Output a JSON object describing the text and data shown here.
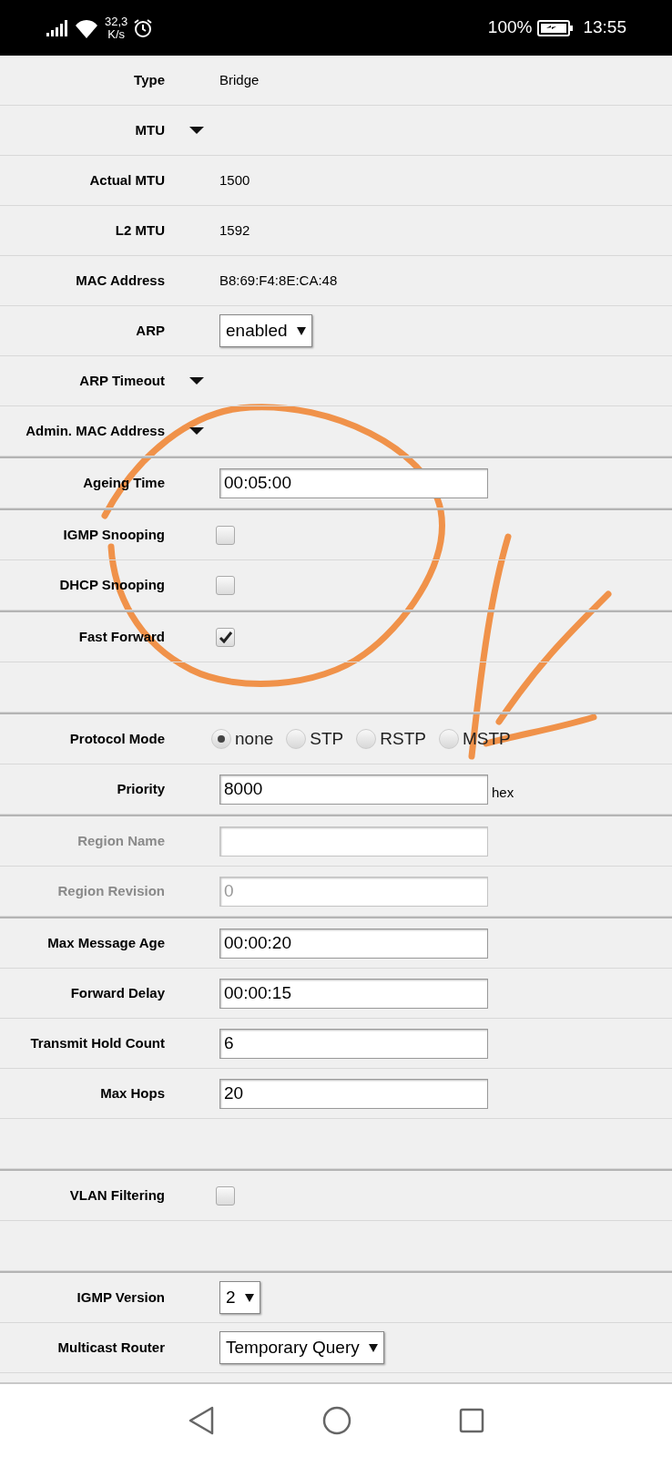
{
  "status_bar": {
    "speed": "32,3",
    "speed_unit": "K/s",
    "battery": "100%",
    "time": "13:55"
  },
  "sections": [
    {
      "rows": [
        {
          "kind": "text",
          "label": "Type",
          "value": "Bridge"
        },
        {
          "kind": "toggle",
          "label": "MTU"
        },
        {
          "kind": "text",
          "label": "Actual MTU",
          "value": "1500"
        },
        {
          "kind": "text",
          "label": "L2 MTU",
          "value": "1592"
        },
        {
          "kind": "text",
          "label": "MAC Address",
          "value": "B8:69:F4:8E:CA:48"
        },
        {
          "kind": "select",
          "label": "ARP",
          "value": "enabled"
        },
        {
          "kind": "toggle",
          "label": "ARP Timeout"
        },
        {
          "kind": "toggle",
          "label": "Admin. MAC Address"
        }
      ]
    },
    {
      "rows": [
        {
          "kind": "input",
          "label": "Ageing Time",
          "value": "00:05:00",
          "disabled": false
        }
      ]
    },
    {
      "rows": [
        {
          "kind": "checkbox",
          "label": "IGMP Snooping",
          "checked": false
        },
        {
          "kind": "checkbox",
          "label": "DHCP Snooping",
          "checked": false
        }
      ]
    },
    {
      "rows": [
        {
          "kind": "checkbox",
          "label": "Fast Forward",
          "checked": true
        },
        {
          "kind": "spacer"
        }
      ]
    },
    {
      "rows": [
        {
          "kind": "radio",
          "label": "Protocol Mode",
          "options": [
            {
              "label": "none",
              "selected": true
            },
            {
              "label": "STP",
              "selected": false
            },
            {
              "label": "RSTP",
              "selected": false
            },
            {
              "label": "MSTP",
              "selected": false
            }
          ]
        },
        {
          "kind": "input",
          "label": "Priority",
          "value": "8000",
          "suffix": "hex",
          "disabled": false
        }
      ]
    },
    {
      "rows": [
        {
          "kind": "input",
          "label": "Region Name",
          "disabled": true
        },
        {
          "kind": "input",
          "label": "Region Revision",
          "value": "0",
          "disabled": true
        }
      ]
    },
    {
      "rows": [
        {
          "kind": "input",
          "label": "Max Message Age",
          "value": "00:00:20",
          "disabled": false
        },
        {
          "kind": "input",
          "label": "Forward Delay",
          "value": "00:00:15",
          "disabled": false
        },
        {
          "kind": "input",
          "label": "Transmit Hold Count",
          "value": "6",
          "disabled": false
        },
        {
          "kind": "input",
          "label": "Max Hops",
          "value": "20",
          "disabled": false
        },
        {
          "kind": "spacer"
        }
      ]
    },
    {
      "rows": [
        {
          "kind": "checkbox",
          "label": "VLAN Filtering",
          "checked": false
        },
        {
          "kind": "spacer"
        }
      ]
    },
    {
      "rows": [
        {
          "kind": "select",
          "label": "IGMP Version",
          "value": "2"
        },
        {
          "kind": "select",
          "label": "Multicast Router",
          "value": "Temporary Query"
        }
      ]
    }
  ]
}
